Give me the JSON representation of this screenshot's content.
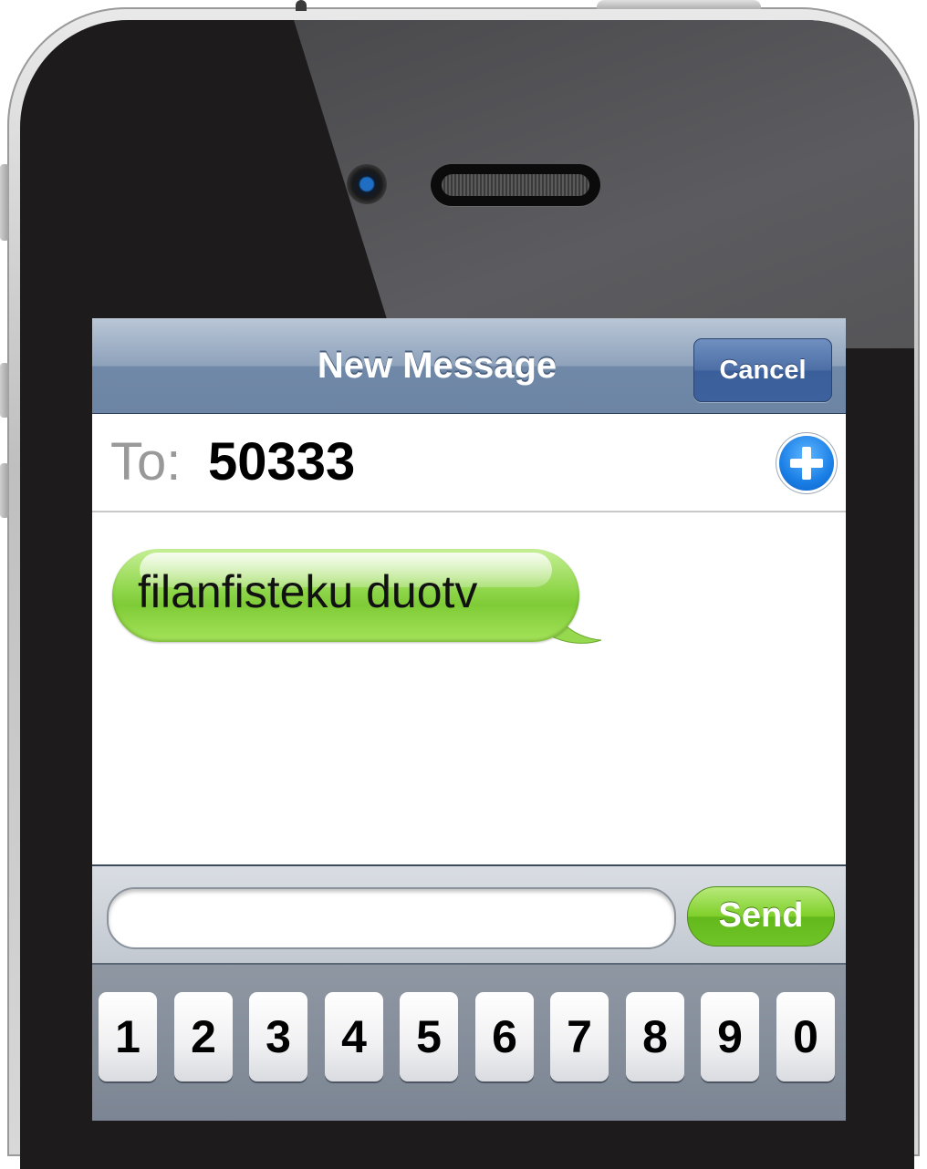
{
  "navbar": {
    "title": "New Message",
    "cancel_label": "Cancel"
  },
  "recipient": {
    "label": "To:",
    "value": "50333"
  },
  "conversation": {
    "messages": [
      {
        "text": "filanfisteku duotv"
      }
    ]
  },
  "compose": {
    "input_value": "",
    "send_label": "Send"
  },
  "keyboard": {
    "keys": [
      "1",
      "2",
      "3",
      "4",
      "5",
      "6",
      "7",
      "8",
      "9",
      "0"
    ]
  },
  "colors": {
    "navbar": "#7a91ae",
    "bubble": "#8fd64a",
    "send_button": "#6fc428",
    "add_button": "#1a7fe6"
  },
  "icons": {
    "add_contact": "plus-circle-icon"
  }
}
